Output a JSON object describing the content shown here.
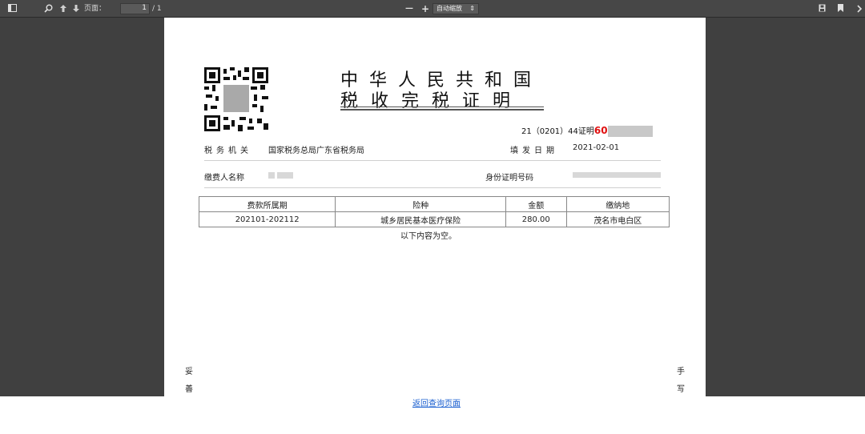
{
  "toolbar": {
    "page_label": "页面：",
    "page_value": "1",
    "page_total": "/ 1",
    "zoom_out": "—",
    "zoom_in": "+",
    "zoom_value": "自动缩放",
    "zoom_caret": "⇕"
  },
  "document": {
    "title_line1": "中华人民共和国",
    "title_line2": "税收完税证明",
    "cert_prefix": "21（0201）44证明",
    "cert_red": "60",
    "tax_authority_label": "税务机关",
    "tax_authority_value": "国家税务总局广东省税务局",
    "issue_date_label": "填发日期",
    "issue_date_value": "2021-02-01",
    "payer_label": "缴费人名称",
    "id_label": "身份证明号码",
    "table": {
      "headers": [
        "费款所属期",
        "险种",
        "金额",
        "缴纳地"
      ],
      "rows": [
        [
          "202101-202112",
          "城乡居民基本医疗保险",
          "280.00",
          "茂名市电白区"
        ]
      ]
    },
    "empty_note": "以下内容为空。",
    "left_side": [
      "妥",
      "善"
    ],
    "right_side": [
      "手",
      "写"
    ]
  },
  "footer": {
    "back_link": "返回查询页面"
  }
}
